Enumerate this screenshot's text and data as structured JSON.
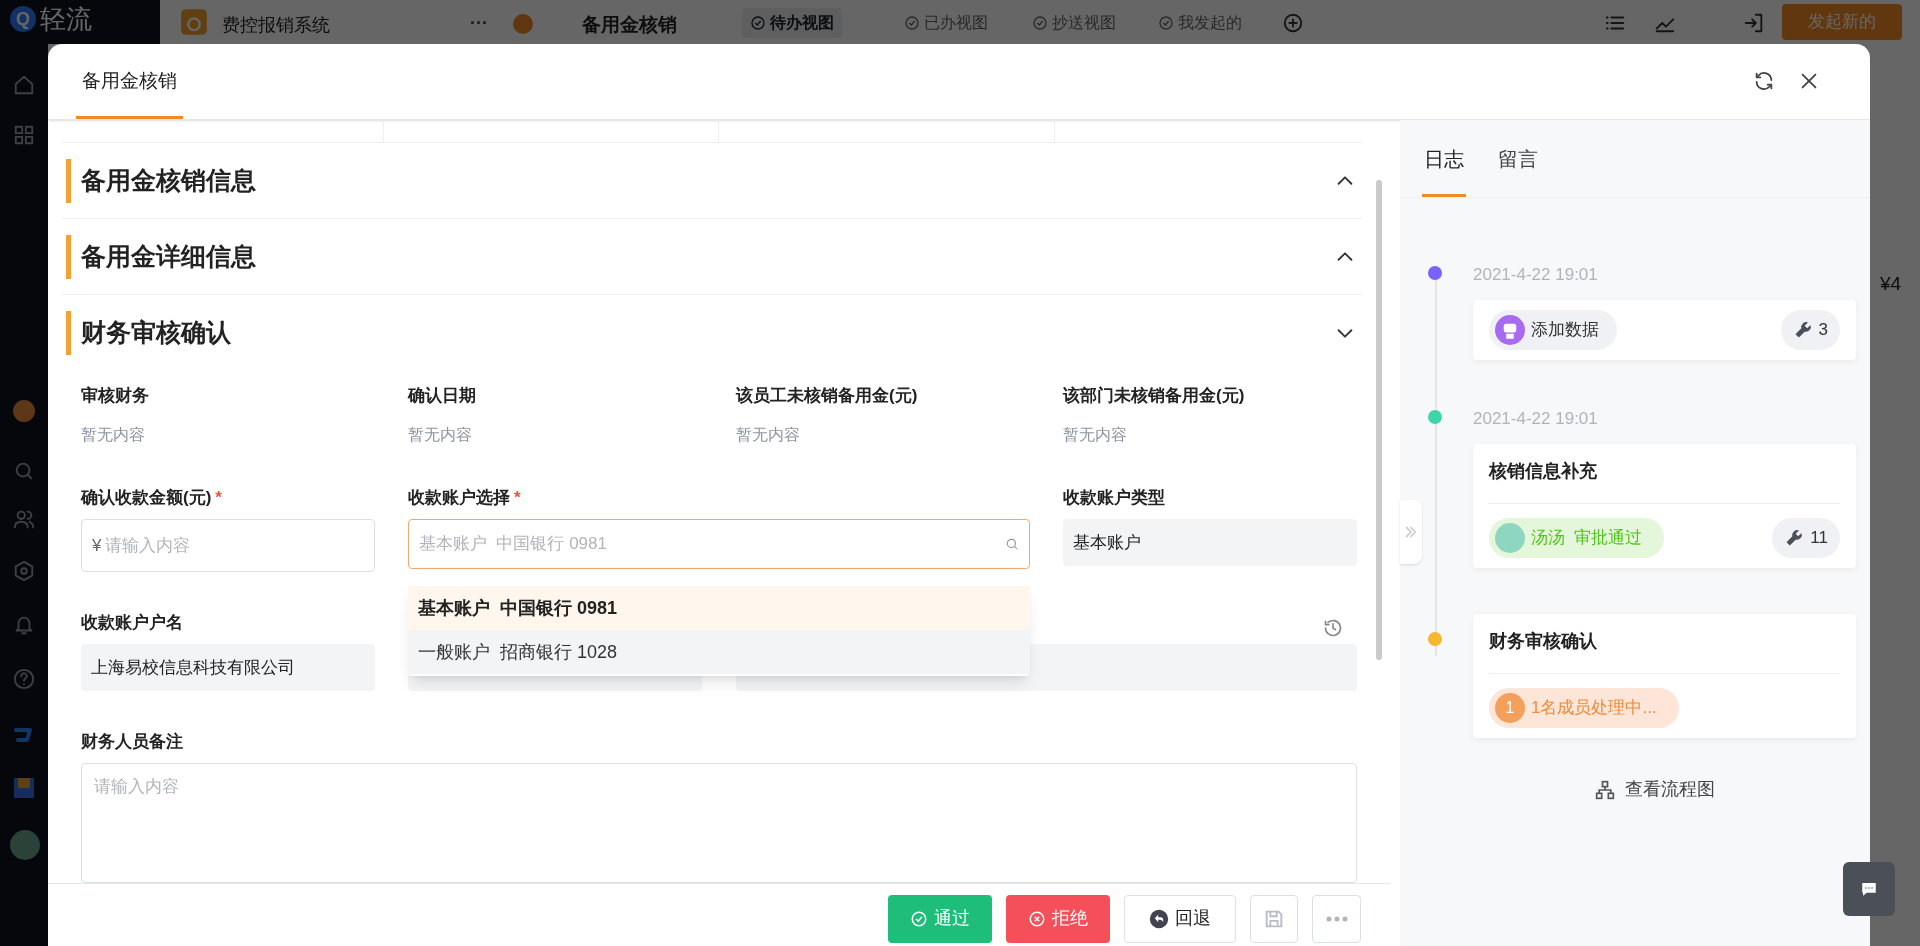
{
  "app": {
    "logo_letter": "Q",
    "logo": "轻流",
    "app_name": "费控报销系统",
    "more": "···",
    "form_name": "备用金核销",
    "views": [
      {
        "label": "待办视图",
        "selected": true
      },
      {
        "label": "已办视图",
        "selected": false
      },
      {
        "label": "抄送视图",
        "selected": false
      },
      {
        "label": "我发起的",
        "selected": false
      }
    ],
    "primary_button": "发起新的",
    "behind_text": "¥4"
  },
  "modal": {
    "title": "备用金核销",
    "sections": [
      {
        "title": "备用金核销信息",
        "expanded": false
      },
      {
        "title": "备用金详细信息",
        "expanded": false
      },
      {
        "title": "财务审核确认",
        "expanded": true
      }
    ],
    "fields": [
      {
        "kind": "readonly",
        "label": "审核财务",
        "value": "暂无内容"
      },
      {
        "kind": "readonly",
        "label": "确认日期",
        "value": "暂无内容"
      },
      {
        "kind": "readonly",
        "label": "该员工未核销备用金(元)",
        "value": "暂无内容"
      },
      {
        "kind": "readonly",
        "label": "该部门未核销备用金(元)",
        "value": "暂无内容"
      },
      {
        "kind": "input",
        "label": "确认收款金额(元)",
        "required_mark": "*",
        "prefix": "¥",
        "placeholder": "请输入内容"
      },
      {
        "kind": "select",
        "label": "收款账户选择",
        "required_mark": "*",
        "placeholder": "基本账户  中国银行 0981"
      },
      {
        "kind": "filled",
        "label": "收款账户类型",
        "value": "基本账户"
      },
      {
        "kind": "filled",
        "label": "收款账户户名",
        "value": "上海易校信息科技有限公司"
      },
      {
        "kind": "covered"
      },
      {
        "kind": "covered_wide"
      },
      {
        "kind": "textarea",
        "label": "财务人员备注",
        "placeholder": "请输入内容"
      }
    ],
    "dropdown": [
      {
        "label": "基本账户  中国银行 0981",
        "selected": true,
        "hovered": false
      },
      {
        "label": "一般账户  招商银行 1028",
        "selected": false,
        "hovered": true
      }
    ],
    "buttons": [
      {
        "kind": "approve",
        "label": "通过"
      },
      {
        "kind": "reject",
        "label": "拒绝"
      },
      {
        "kind": "back",
        "label": "回退"
      },
      {
        "kind": "save"
      },
      {
        "kind": "more"
      }
    ]
  },
  "side": {
    "tabs": [
      {
        "label": "日志",
        "selected": true
      },
      {
        "label": "留言",
        "selected": false
      }
    ],
    "timeline": [
      {
        "time": "2021-4-22 19:01",
        "color": "#7b61ff",
        "chip": {
          "kind": "robot",
          "label": "添加数据"
        },
        "count": "3"
      },
      {
        "time": "2021-4-22 19:01",
        "color": "#3ed6a8",
        "title": "核销信息补充",
        "chip": {
          "kind": "approved",
          "label": "汤汤  审批通过"
        },
        "count": "11"
      },
      {
        "color": "#f5b82e",
        "title": "财务审核确认",
        "chip": {
          "kind": "pending",
          "badge": "1",
          "label": "1名成员处理中..."
        }
      }
    ],
    "flow_link": "查看流程图"
  }
}
